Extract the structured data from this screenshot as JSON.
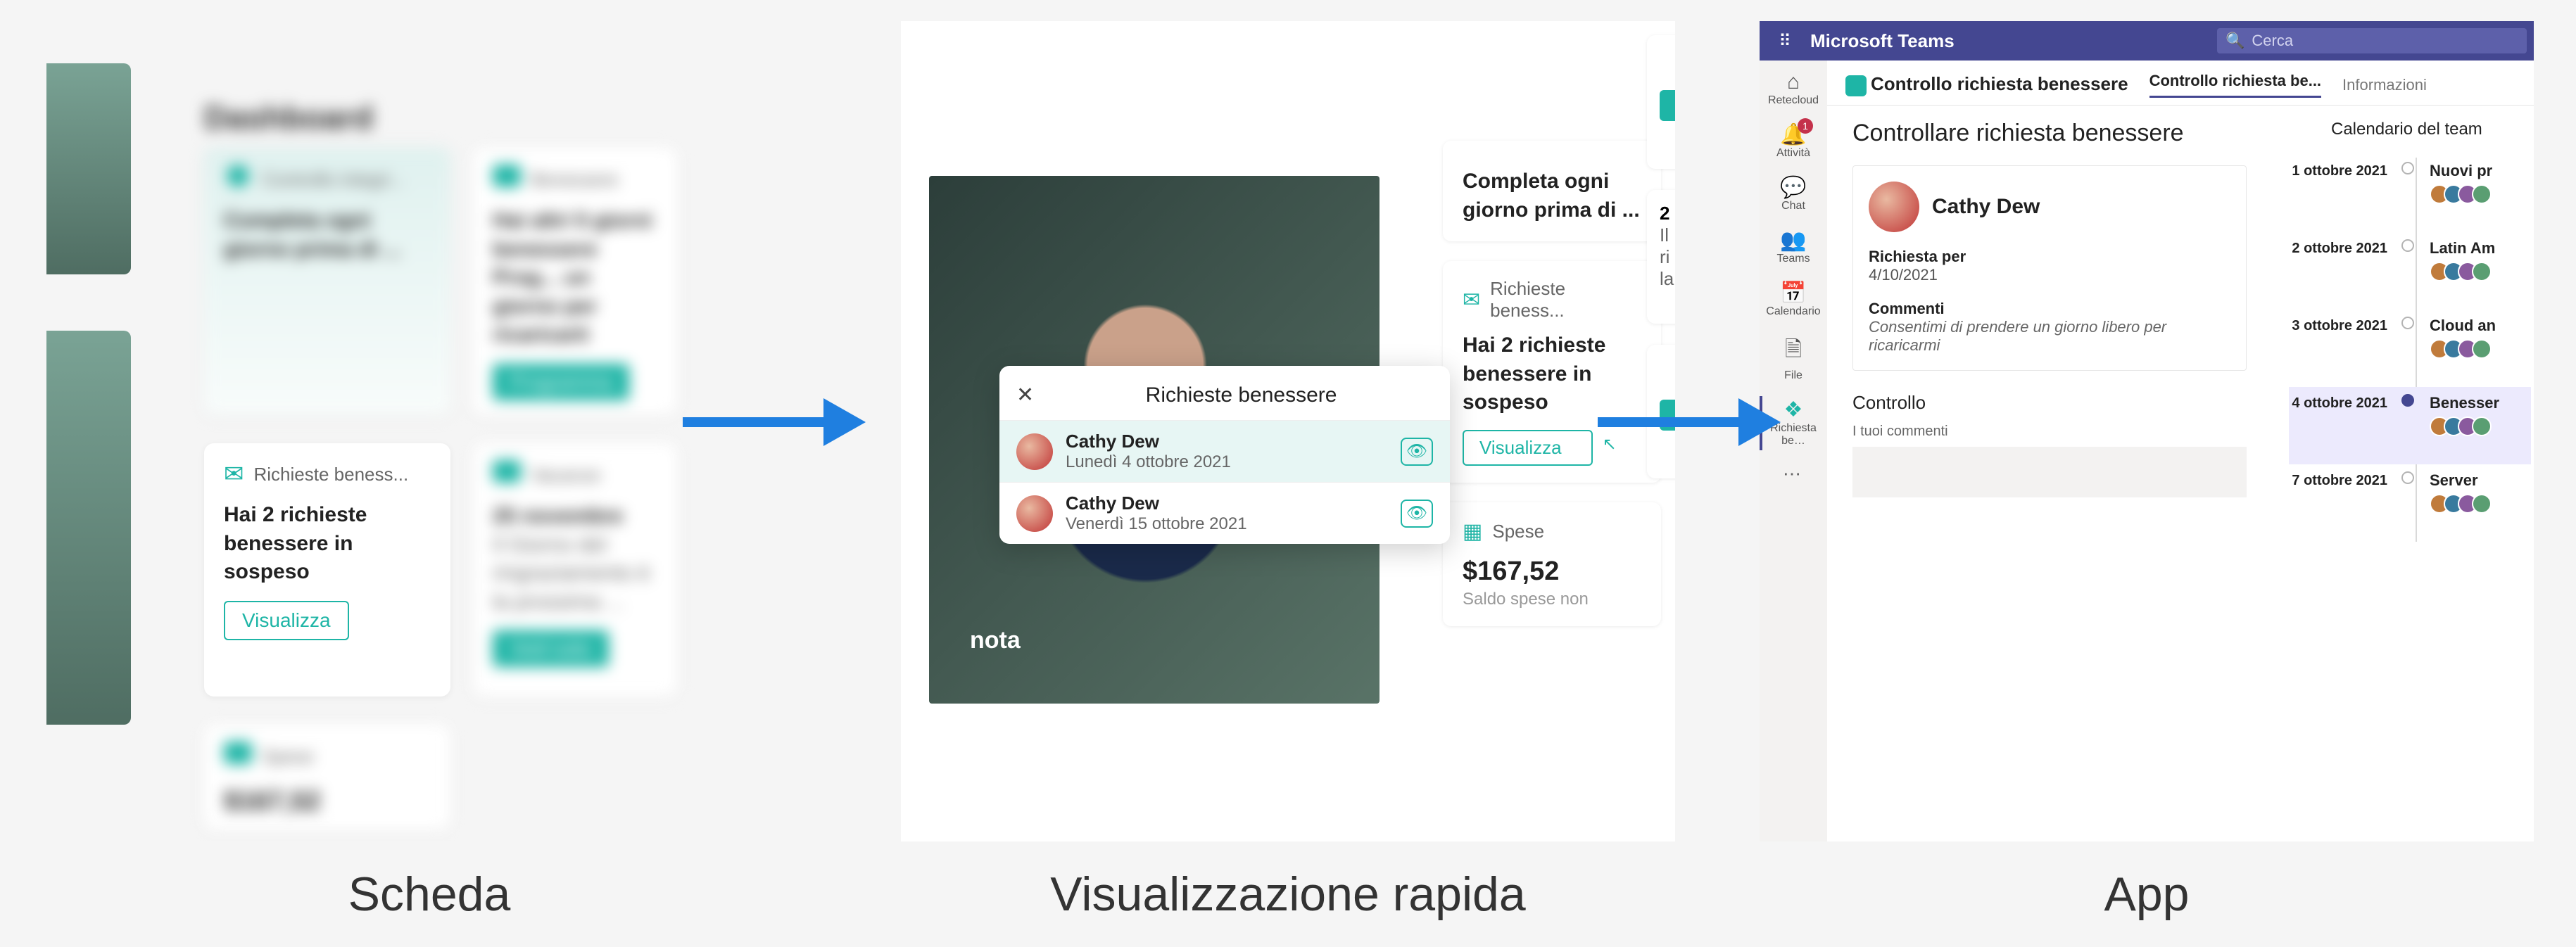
{
  "captions": {
    "panel1": "Scheda",
    "panel2": "Visualizzazione rapida",
    "panel3": "App"
  },
  "panel1": {
    "dash_title": "Dashboard",
    "cards": {
      "controllo": {
        "header": "Controllo integri...",
        "body": "Completa ogni giorno prima di ..."
      },
      "benessere": {
        "header": "Benessere",
        "body": "Hai altri 5 giorni benessere Prog... un giorno per ricaricarti",
        "pill": "Programma"
      },
      "richieste": {
        "header": "Richieste beness...",
        "body": "Hai 2 richieste benessere in sospeso",
        "pill": "Visualizza"
      },
      "vacanze": {
        "header": "Vacanze",
        "title": "25 novembre",
        "body": "Il Giorno del ringraziamento è la prossima ...",
        "pill": "Vedi tutto"
      },
      "spese": {
        "header": "Spese",
        "amount": "$167,52"
      }
    }
  },
  "panel2": {
    "nota_label": "nota",
    "card_top": {
      "body": "Completa ogni giorno prima di ..."
    },
    "card_req": {
      "header": "Richieste beness...",
      "body": "Hai 2 richieste benessere in sospeso",
      "pill": "Visualizza"
    },
    "card_spese": {
      "header": "Spese",
      "amount": "$167,52",
      "sub": "Saldo spese non"
    },
    "side_stub": {
      "line1": "2",
      "line2": "Il",
      "line3": "ri",
      "line4": "la"
    },
    "popover": {
      "title": "Richieste benessere",
      "items": [
        {
          "name": "Cathy Dew",
          "date": "Lunedì 4 ottobre 2021"
        },
        {
          "name": "Cathy Dew",
          "date": "Venerdì 15 ottobre 2021"
        }
      ]
    }
  },
  "panel3": {
    "brand": "Microsoft Teams",
    "search_ph": "Cerca",
    "rail": {
      "retecloud": "Retecloud",
      "attivita": "Attività",
      "chat": "Chat",
      "teams": "Teams",
      "calendario": "Calendario",
      "file": "File",
      "richiesta": "Richiesta be…",
      "badge": "1"
    },
    "tabs": {
      "appname": "Controllo richiesta benessere",
      "tab1": "Controllo richiesta be...",
      "tab2": "Informazioni"
    },
    "page_title": "Controllare richiesta benessere",
    "request": {
      "name": "Cathy Dew",
      "lbl_req": "Richiesta per",
      "val_req": "4/10/2021",
      "lbl_com": "Commenti",
      "val_com": "Consentimi di prendere un giorno libero per ricaricarmi"
    },
    "control": {
      "heading": "Controllo",
      "sub": "I tuoi commenti"
    },
    "calendar": {
      "heading": "Calendario del team",
      "rows": [
        {
          "date": "1 ottobre 2021",
          "evt": "Nuovi pr"
        },
        {
          "date": "2 ottobre 2021",
          "evt": "Latin Am"
        },
        {
          "date": "3 ottobre 2021",
          "evt": "Cloud an"
        },
        {
          "date": "4 ottobre 2021",
          "evt": "Benesser",
          "hl": true
        },
        {
          "date": "7 ottobre 2021",
          "evt": "Server"
        }
      ],
      "avatar_colors": [
        "#c07b3b",
        "#397a9e",
        "#8a5a9e",
        "#5a9e72"
      ]
    }
  }
}
